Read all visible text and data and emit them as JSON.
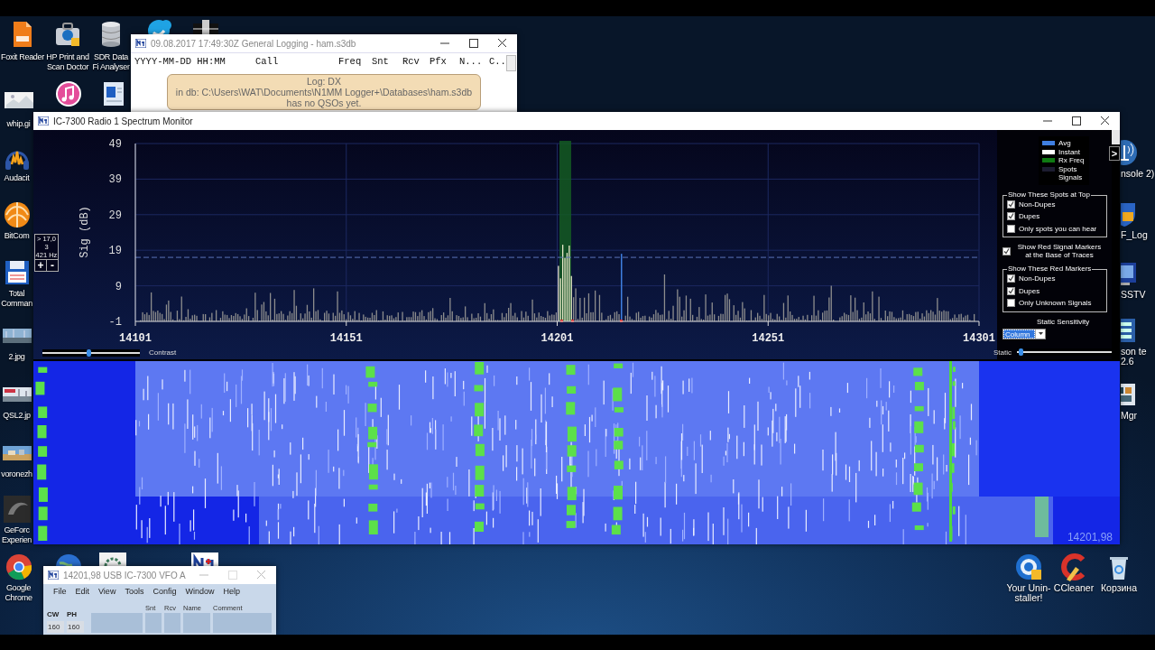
{
  "desktop_icons": [
    {
      "label": "Foxit Reader"
    },
    {
      "label": "HP Print and Scan Doctor"
    },
    {
      "label": "SDR Data Fi Analyser"
    },
    {
      "label": "whip.gi"
    },
    {
      "label": "Audacit"
    },
    {
      "label": "BitCom"
    },
    {
      "label": "Total Comman"
    },
    {
      "label": "2.jpg"
    },
    {
      "label": "QSL2.jp"
    },
    {
      "label": "voronezh"
    },
    {
      "label": "GeForc Experien"
    },
    {
      "label": "Google Chrome"
    },
    {
      "label": "nsole 2)"
    },
    {
      "label": "F_Log"
    },
    {
      "label": "SSTV"
    },
    {
      "label": "son te 2.6"
    },
    {
      "label": "Mgr"
    },
    {
      "label": "Your Unin-staller!"
    },
    {
      "label": "CCleaner"
    },
    {
      "label": "Корзина"
    }
  ],
  "general_logging_window": {
    "title": "09.08.2017 17:49:30Z  General Logging - ham.s3db",
    "columns": [
      "YYYY-MM-DD HH:MM",
      "Call",
      "Freq",
      "Snt",
      "Rcv",
      "Pfx",
      "N...",
      "C.."
    ],
    "message": [
      "Log: DX",
      "in db: C:\\Users\\WAT\\Documents\\N1MM Logger+\\Databases\\ham.s3db",
      "has no QSOs yet."
    ]
  },
  "spectrum_window": {
    "title": "IC-7300 Radio 1 Spectrum Monitor",
    "y_axis_title": "Sig (dB)",
    "y_labels": [
      "49",
      "39",
      "29",
      "19",
      "9",
      "-1"
    ],
    "x_labels": [
      "14101",
      "14151",
      "14201",
      "14251",
      "14301"
    ],
    "readout": [
      "> 17,0",
      "3",
      "421 Hz"
    ],
    "step_buttons": [
      "+",
      "-"
    ],
    "contrast": {
      "label": "Contrast",
      "level": 0.47
    },
    "static": {
      "label": "Static",
      "level": 0.04
    },
    "expand_button": ">",
    "legend": [
      {
        "label": "Avg",
        "color": "#3f7fe0"
      },
      {
        "label": "Instant",
        "color": "#ffffff"
      },
      {
        "label": "Rx Freq",
        "color": "#0f7a12"
      },
      {
        "label": "Spots",
        "color": "#1c1c30"
      },
      {
        "label": "Signals"
      }
    ],
    "spot_group": {
      "title": "Show These Spots at Top",
      "options": [
        {
          "label": "Non-Dupes",
          "checked": true
        },
        {
          "label": "Dupes",
          "checked": true
        },
        {
          "label": "Only spots you can hear",
          "checked": false
        }
      ]
    },
    "red_markers_toggle": {
      "label": "Show Red Signal Markers at the Base of Traces",
      "checked": true
    },
    "marker_group": {
      "title": "Show These Red Markers",
      "options": [
        {
          "label": "Non-Dupes",
          "checked": true
        },
        {
          "label": "Dupes",
          "checked": true
        },
        {
          "label": "Only Unknown Signals",
          "checked": false
        }
      ]
    },
    "sensitivity": {
      "label": "Static Sensitivity",
      "value": "Column",
      "highlighted": true
    },
    "waterfall_frequency": "14201,98"
  },
  "vfo_window": {
    "title": "14201,98 USB IC-7300 VFO A",
    "menu": [
      "File",
      "Edit",
      "View",
      "Tools",
      "Config",
      "Window",
      "Help"
    ],
    "band_headers": [
      "CW",
      "PH"
    ],
    "band_values": [
      "160",
      "160"
    ],
    "field_labels": [
      "Snt",
      "Rcv",
      "Name",
      "Comment"
    ]
  }
}
